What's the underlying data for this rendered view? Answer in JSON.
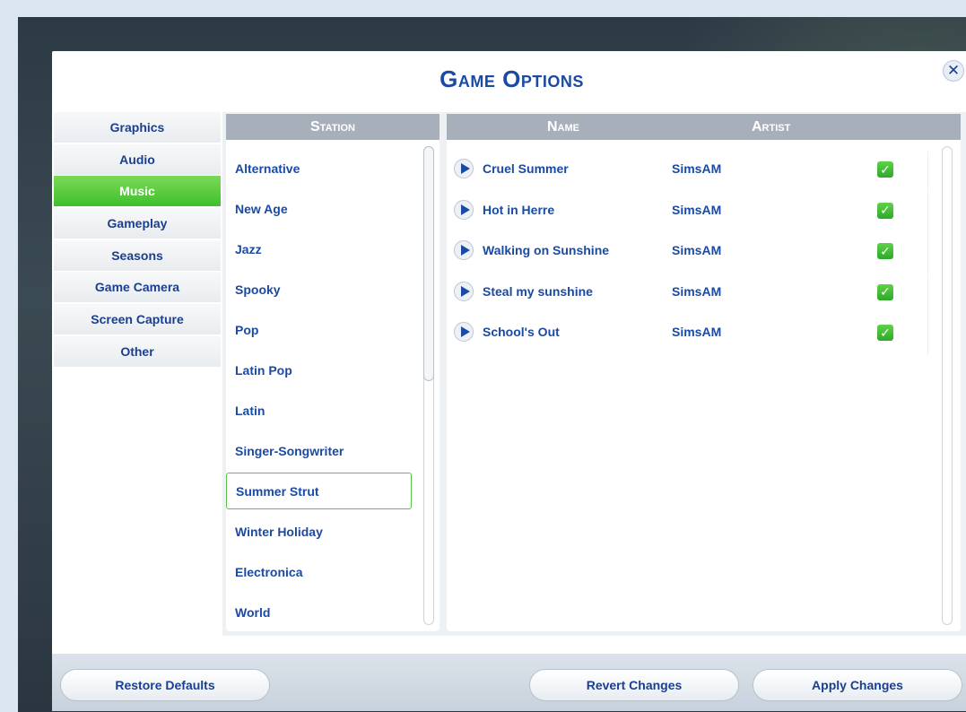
{
  "dialog": {
    "title": "Game Options"
  },
  "nav": {
    "items": [
      {
        "label": "Graphics",
        "active": false
      },
      {
        "label": "Audio",
        "active": false
      },
      {
        "label": "Music",
        "active": true
      },
      {
        "label": "Gameplay",
        "active": false
      },
      {
        "label": "Seasons",
        "active": false
      },
      {
        "label": "Game Camera",
        "active": false
      },
      {
        "label": "Screen Capture",
        "active": false
      },
      {
        "label": "Other",
        "active": false
      }
    ]
  },
  "stations": {
    "header": "Station",
    "selected": "Summer Strut",
    "items": [
      "Alternative",
      "New Age",
      "Jazz",
      "Spooky",
      "Pop",
      "Latin Pop",
      "Latin",
      "Singer-Songwriter",
      "Summer Strut",
      "Winter Holiday",
      "Electronica",
      "World"
    ]
  },
  "tracks": {
    "name_header": "Name",
    "artist_header": "Artist",
    "rows": [
      {
        "name": "Cruel Summer",
        "artist": "SimsAM",
        "checked": true
      },
      {
        "name": "Hot in Herre",
        "artist": "SimsAM",
        "checked": true
      },
      {
        "name": "Walking on Sunshine",
        "artist": "SimsAM",
        "checked": true
      },
      {
        "name": "Steal my sunshine",
        "artist": "SimsAM",
        "checked": true
      },
      {
        "name": "School's Out",
        "artist": "SimsAM",
        "checked": true
      }
    ]
  },
  "footer": {
    "restore_label": "Restore Defaults",
    "revert_label": "Revert Changes",
    "apply_label": "Apply Changes"
  },
  "icons": {
    "close": "close-icon",
    "play": "play-icon",
    "check": "check-icon"
  },
  "colors": {
    "accent_blue": "#1a4aa3",
    "active_green": "#3fbf2c",
    "header_gray": "#a7afba"
  }
}
